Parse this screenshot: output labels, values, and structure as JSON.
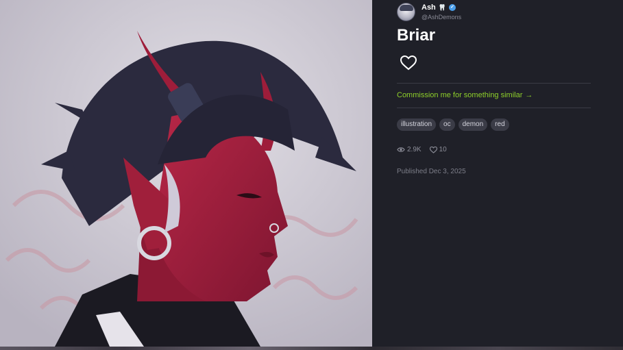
{
  "artwork": {
    "alt": "Briar",
    "colors": {
      "background": "#c9c6cf",
      "skin": "#a31e3c",
      "hair": "#2b2a3e"
    }
  },
  "author": {
    "name": "Ash",
    "emoji": "🦷",
    "handle": "@AshDemons",
    "verified": true
  },
  "post": {
    "title": "Briar",
    "liked": false
  },
  "commission_link": {
    "label": "Commission me for something similar",
    "arrow": "→",
    "color": "#8fd12a"
  },
  "tags": [
    "illustration",
    "oc",
    "demon",
    "red"
  ],
  "stats": {
    "views": "2.9K",
    "likes": "10"
  },
  "published": "Published Dec 3, 2025"
}
